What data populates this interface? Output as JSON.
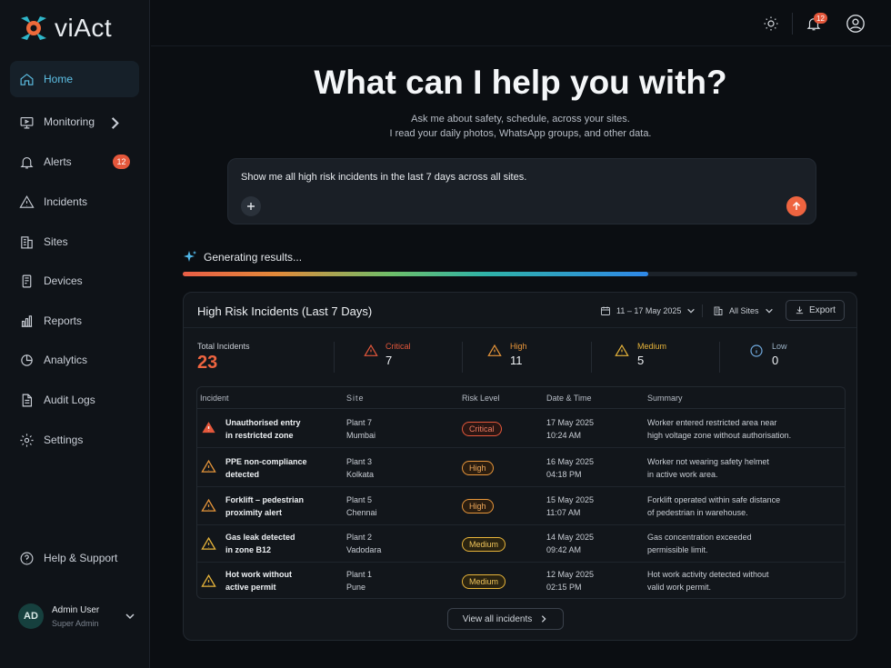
{
  "brand": {
    "name": "viAct"
  },
  "sidebar": {
    "items": [
      {
        "label": "Home"
      },
      {
        "label": "Monitoring"
      },
      {
        "label": "Alerts",
        "badge": "12"
      },
      {
        "label": "Incidents"
      },
      {
        "label": "Sites"
      },
      {
        "label": "Devices"
      },
      {
        "label": "Reports"
      },
      {
        "label": "Analytics"
      },
      {
        "label": "Audit Logs"
      },
      {
        "label": "Settings"
      }
    ],
    "help_label": "Help & Support",
    "user": {
      "initials": "AD",
      "name": "Admin User",
      "role": "Super Admin"
    }
  },
  "topbar": {
    "notification_count": "12"
  },
  "hero": {
    "headline": "What can I help you with?",
    "sub_line1": "Ask me about safety, schedule, across your sites.",
    "sub_line2": "I read your daily photos, WhatsApp groups, and other data."
  },
  "prompt": {
    "text": "Show me all high risk incidents in the last 7 days across all sites."
  },
  "status": {
    "label": "Generating results...",
    "progress": 0.69
  },
  "panel": {
    "title": "High Risk Incidents (Last 7 Days)",
    "date_range": "11 – 17 May 2025",
    "site_filter": "All Sites",
    "export_label": "Export",
    "stats": {
      "total_label": "Total Incidents",
      "total": "23",
      "critical_label": "Critical",
      "critical": "7",
      "high_label": "High",
      "high": "11",
      "medium_label": "Medium",
      "medium": "5",
      "low_label": "Low",
      "low": "0"
    },
    "columns": [
      "Incident",
      "Site",
      "Risk Level",
      "Date & Time",
      "Summary"
    ],
    "rows": [
      {
        "incident1": "Unauthorised entry",
        "incident2": "in restricted zone",
        "site1": "Plant 7",
        "site2": "Mumbai",
        "risk": "Critical",
        "date": "17 May 2025",
        "time": "10:24 AM",
        "summary1": "Worker entered restricted area near",
        "summary2": "high voltage zone without authorisation."
      },
      {
        "incident1": "PPE non-compliance",
        "incident2": "detected",
        "site1": "Plant 3",
        "site2": "Kolkata",
        "risk": "High",
        "date": "16 May 2025",
        "time": "04:18 PM",
        "summary1": "Worker not wearing safety helmet",
        "summary2": "in active work area."
      },
      {
        "incident1": "Forklift – pedestrian",
        "incident2": "proximity alert",
        "site1": "Plant 5",
        "site2": "Chennai",
        "risk": "High",
        "date": "15 May 2025",
        "time": "11:07 AM",
        "summary1": "Forklift operated within safe distance",
        "summary2": "of pedestrian in warehouse."
      },
      {
        "incident1": "Gas leak detected",
        "incident2": "in zone B12",
        "site1": "Plant 2",
        "site2": "Vadodara",
        "risk": "Medium",
        "date": "14 May 2025",
        "time": "09:42 AM",
        "summary1": "Gas concentration exceeded",
        "summary2": "permissible limit."
      },
      {
        "incident1": "Hot work without",
        "incident2": "active permit",
        "site1": "Plant 1",
        "site2": "Pune",
        "risk": "Medium",
        "date": "12 May 2025",
        "time": "02:15 PM",
        "summary1": "Hot work activity detected without",
        "summary2": "valid work permit."
      }
    ],
    "view_all_label": "View all incidents"
  },
  "colors": {
    "accent": "#5ec1e6",
    "critical": "#e4573b",
    "high": "#e8963a",
    "medium": "#e7b43a",
    "low": "#6fa8dc"
  }
}
